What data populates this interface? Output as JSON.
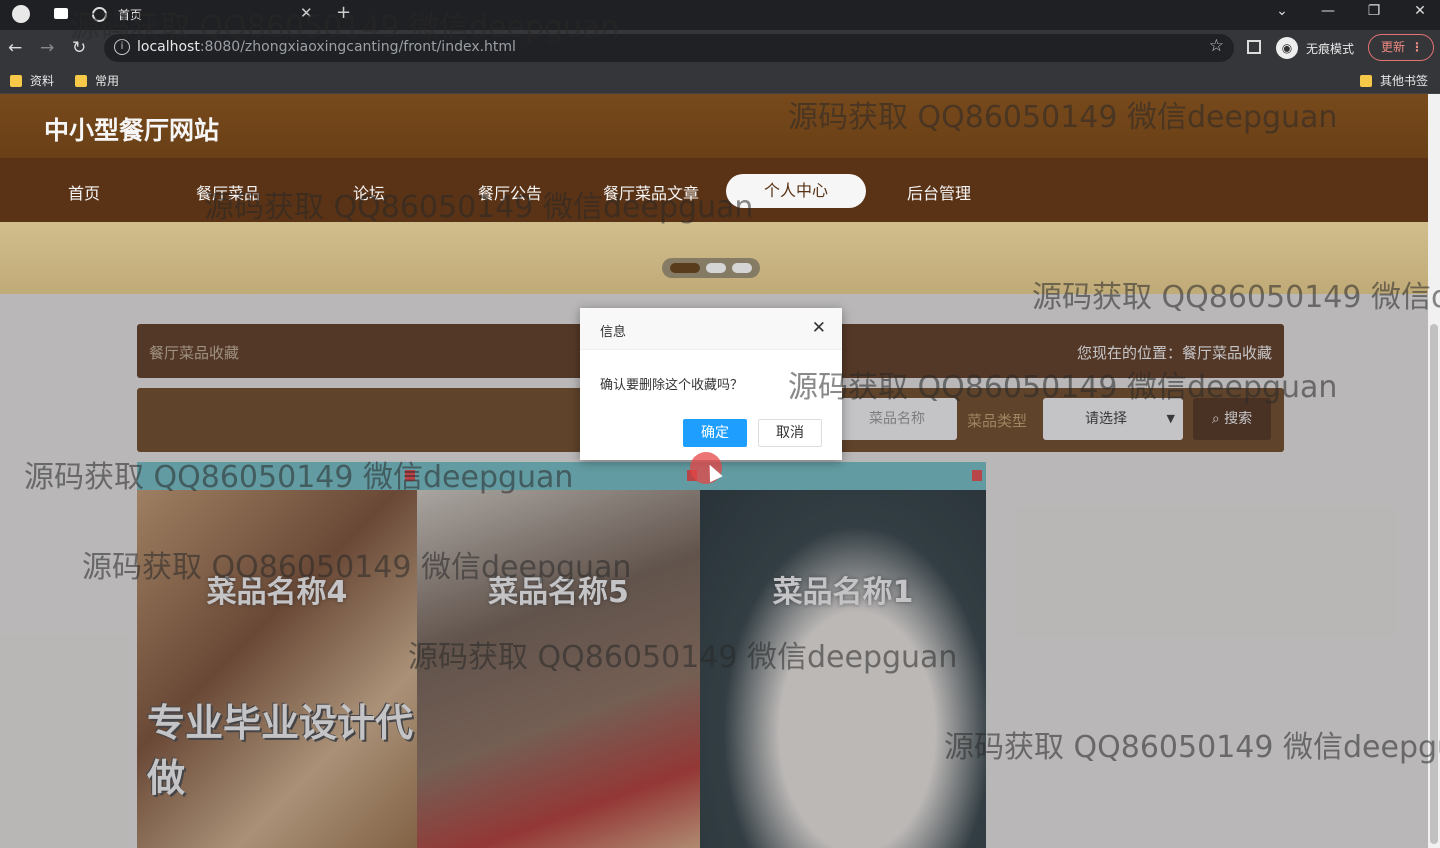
{
  "browser": {
    "tab_title": "首页",
    "url_host": "localhost",
    "url_rest": ":8080/zhongxiaoxingcanting/front/index.html",
    "incognito_label": "无痕模式",
    "update_label": "更新",
    "bookmarks": [
      "资料",
      "常用"
    ],
    "other_bookmarks": "其他书签"
  },
  "site": {
    "title": "中小型餐厅网站",
    "nav": [
      "首页",
      "餐厅菜品",
      "论坛",
      "餐厅公告",
      "餐厅菜品文章",
      "个人中心",
      "后台管理"
    ],
    "active_nav": "个人中心"
  },
  "breadcrumb": {
    "section": "餐厅菜品收藏",
    "location": "您现在的位置：餐厅菜品收藏"
  },
  "search": {
    "name_placeholder": "菜品名称",
    "type_label": "菜品类型",
    "type_selected": "请选择",
    "button": "搜索"
  },
  "cards": [
    {
      "name": "菜品名称4"
    },
    {
      "name": "菜品名称5"
    },
    {
      "name": "菜品名称1"
    }
  ],
  "promo_text": "专业毕业设计代做",
  "dialog": {
    "title": "信息",
    "message": "确认要删除这个收藏吗？",
    "ok": "确定",
    "cancel": "取消"
  },
  "watermark": "源码获取 QQ86050149 微信deepguan"
}
